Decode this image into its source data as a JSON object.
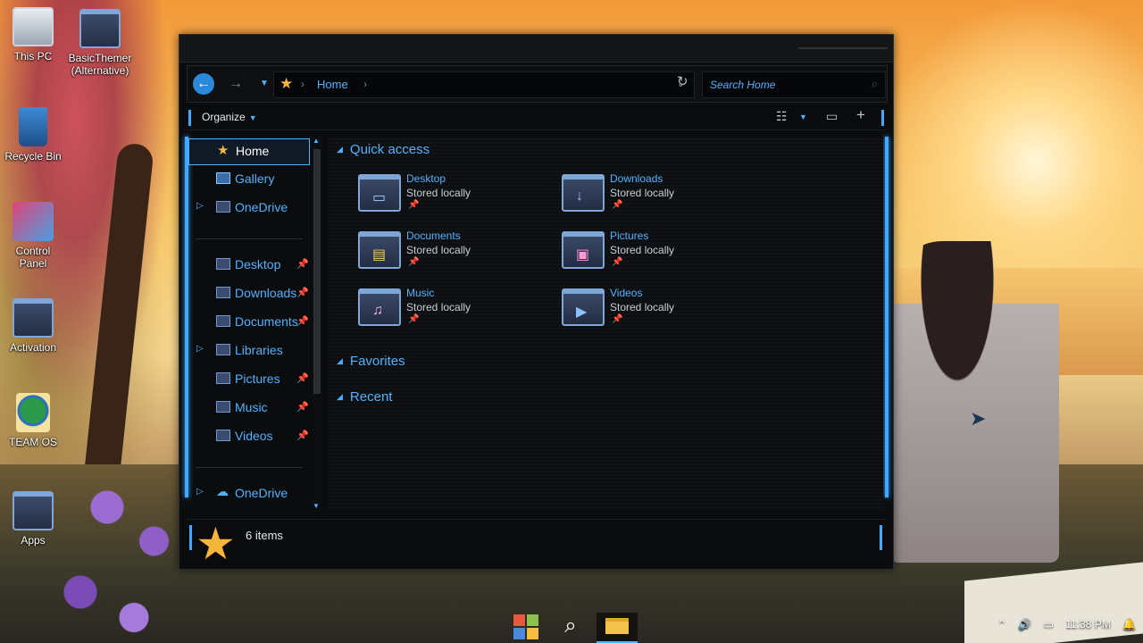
{
  "desktop": {
    "icons": [
      {
        "label": "This PC",
        "icon": "monitor-icon"
      },
      {
        "label": "BasicThemer (Alternative)",
        "icon": "folder-icon"
      },
      {
        "label": "Recycle Bin",
        "icon": "recycle-bin-icon"
      },
      {
        "label": "Control Panel",
        "icon": "control-panel-icon"
      },
      {
        "label": "Activation",
        "icon": "folder-icon"
      },
      {
        "label": "TEAM OS",
        "icon": "globe-shortcut-icon"
      },
      {
        "label": "Apps",
        "icon": "folder-icon"
      }
    ]
  },
  "explorer": {
    "address": {
      "crumb": "Home",
      "separator": "›"
    },
    "search": {
      "placeholder": "Search Home"
    },
    "toolbar": {
      "organize_label": "Organize"
    },
    "sidebar": {
      "home": "Home",
      "gallery": "Gallery",
      "onedrive_1": "OneDrive",
      "pinned": [
        {
          "label": "Desktop",
          "pinned": true
        },
        {
          "label": "Downloads",
          "pinned": true
        },
        {
          "label": "Documents",
          "pinned": true
        },
        {
          "label": "Libraries",
          "pinned": false
        },
        {
          "label": "Pictures",
          "pinned": true
        },
        {
          "label": "Music",
          "pinned": true
        },
        {
          "label": "Videos",
          "pinned": true
        }
      ],
      "onedrive_2": "OneDrive"
    },
    "sections": {
      "quick_access": "Quick access",
      "favorites": "Favorites",
      "recent": "Recent"
    },
    "quick_access_items": [
      {
        "name": "Desktop",
        "sub": "Stored locally",
        "icon": "desktop-folder-icon"
      },
      {
        "name": "Downloads",
        "sub": "Stored locally",
        "icon": "downloads-folder-icon"
      },
      {
        "name": "Documents",
        "sub": "Stored locally",
        "icon": "documents-folder-icon"
      },
      {
        "name": "Pictures",
        "sub": "Stored locally",
        "icon": "pictures-folder-icon"
      },
      {
        "name": "Music",
        "sub": "Stored locally",
        "icon": "music-folder-icon"
      },
      {
        "name": "Videos",
        "sub": "Stored locally",
        "icon": "videos-folder-icon"
      }
    ],
    "status": {
      "count": "6 items"
    }
  },
  "taskbar": {
    "clock": "11:38 PM"
  },
  "colors": {
    "accent": "#4fb2ff",
    "star": "#f6b43a",
    "window_bg": "#0b0c0e"
  }
}
